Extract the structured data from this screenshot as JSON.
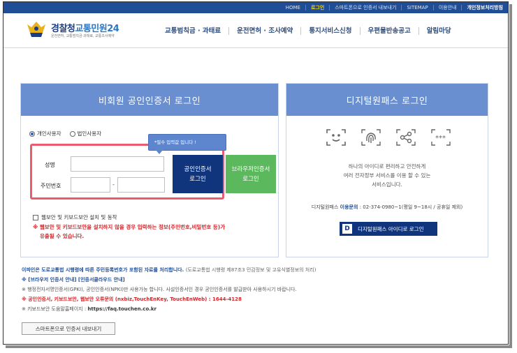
{
  "topbar": {
    "items": [
      "HOME",
      "로그인",
      "스마트폰으로 인증서 내보내기",
      "SITEMAP",
      "이용안내",
      "개인정보처리방침"
    ]
  },
  "logo": {
    "title_main": "경찰청",
    "title_accent": "교통민원24",
    "subtitle": "운전면허, 교통범칙금·과태료, 교통조사예약"
  },
  "gnb": [
    "교통범칙금 · 과태료",
    "운전면허 · 조사예약",
    "통지서비스신청",
    "우편물반송공고",
    "알림마당"
  ],
  "left_panel": {
    "title": "비회원 공인인증서 로그인",
    "radio_personal": "개인사용자",
    "radio_corporate": "법인사용자",
    "tooltip": "*필수 입력값 입니다 !",
    "name_label": "성명",
    "rrn_label": "주민번호",
    "rrn_dash": "-",
    "btn_cert_line1": "공인인증서",
    "btn_cert_line2": "로그인",
    "btn_browser_line1": "브라우저인증서",
    "btn_browser_line2": "로그인",
    "check_label": "웹보안 및 키보드보안 설치 및 동작",
    "warning_line1": "※ 웹보안 및 키보드보안을 설치하지 않을 경우 입력하는 정보(주민번호,비밀번호 등)가",
    "warning_line2": "유출될 수 있습니다."
  },
  "right_panel": {
    "title": "디지털원패스 로그인",
    "icons": [
      "face-recognition-icon",
      "fingerprint-icon",
      "share-node-icon",
      "password-dots-icon"
    ],
    "desc_line1": "하나의 아이디로 편리하고 안전하게",
    "desc_line2": "여러 전자정부 서비스를 이용 할 수 있는",
    "desc_line3": "서비스입니다.",
    "contact_prefix": "디지털원패스",
    "contact_label": "이용문의",
    "contact_value": ": 02-374-0980~1(평일 9~18시 / 공휴일 제외)",
    "btn_badge": "D",
    "btn_label": "디지털원패스 아이디로 로그인"
  },
  "notices": {
    "line1_main": "이파인은 도로교통법 시행령에 따른 주민등록번호가 포함된 자료를 처리합니다.",
    "line1_sub": "(도로교통법 시행령 제87조3 민감정보 및 고유식별정보의 처리)",
    "line2": "※ [브라우저 인증서 안내] [인증서클라우드 안내]",
    "line3": "※ 행정전자서명인증서(GPKI), 공인인증서(NPKI)만 사용가능 합니다. 사설인증서인 경우 공인인증서를 발급받아 사용하시기 바랍니다.",
    "line4": "※ 공인인증서, 키보드보안, 웹보안 오류문의 (nxbiz,TouchEnKey, TouchEnWeb) : 1644-4128",
    "line5_prefix": "※ 키보드보안 도움말홈페이지 :",
    "line5_url": "https://faq.touchen.co.kr"
  },
  "btn_smart": "스마트폰으로 인증서 내보내기"
}
